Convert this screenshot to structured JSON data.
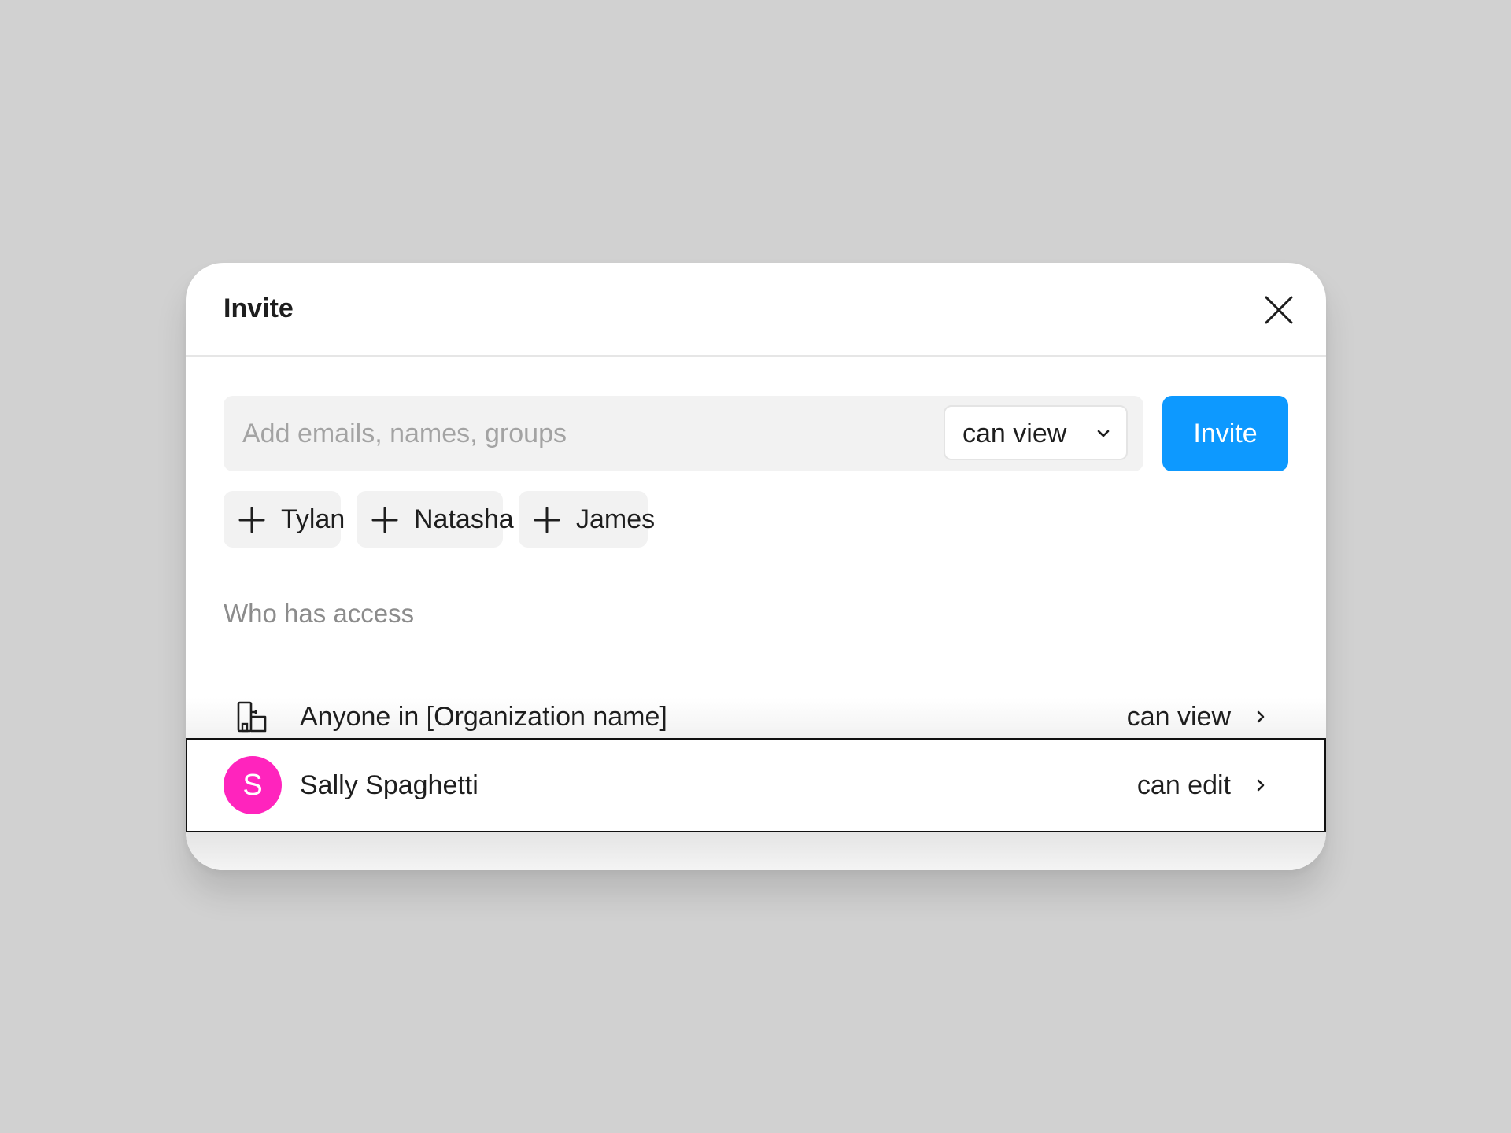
{
  "dialog": {
    "title": "Invite"
  },
  "invite_form": {
    "placeholder": "Add emails, names, groups",
    "value": "",
    "permission": "can view",
    "permission_options": [
      "can view"
    ],
    "invite_label": "Invite",
    "accent_color": "#0d99ff"
  },
  "suggestions": [
    {
      "label": "Tylan"
    },
    {
      "label": "Natasha"
    },
    {
      "label": "James"
    }
  ],
  "access": {
    "section_title": "Who has access",
    "entries": [
      {
        "name": "Anyone in [Organization name]",
        "permission": "can view",
        "icon": "organization-icon"
      },
      {
        "name": "Sally Spaghetti",
        "permission": "can edit",
        "avatar_initial": "S",
        "avatar_color": "#ff24bd"
      }
    ]
  }
}
